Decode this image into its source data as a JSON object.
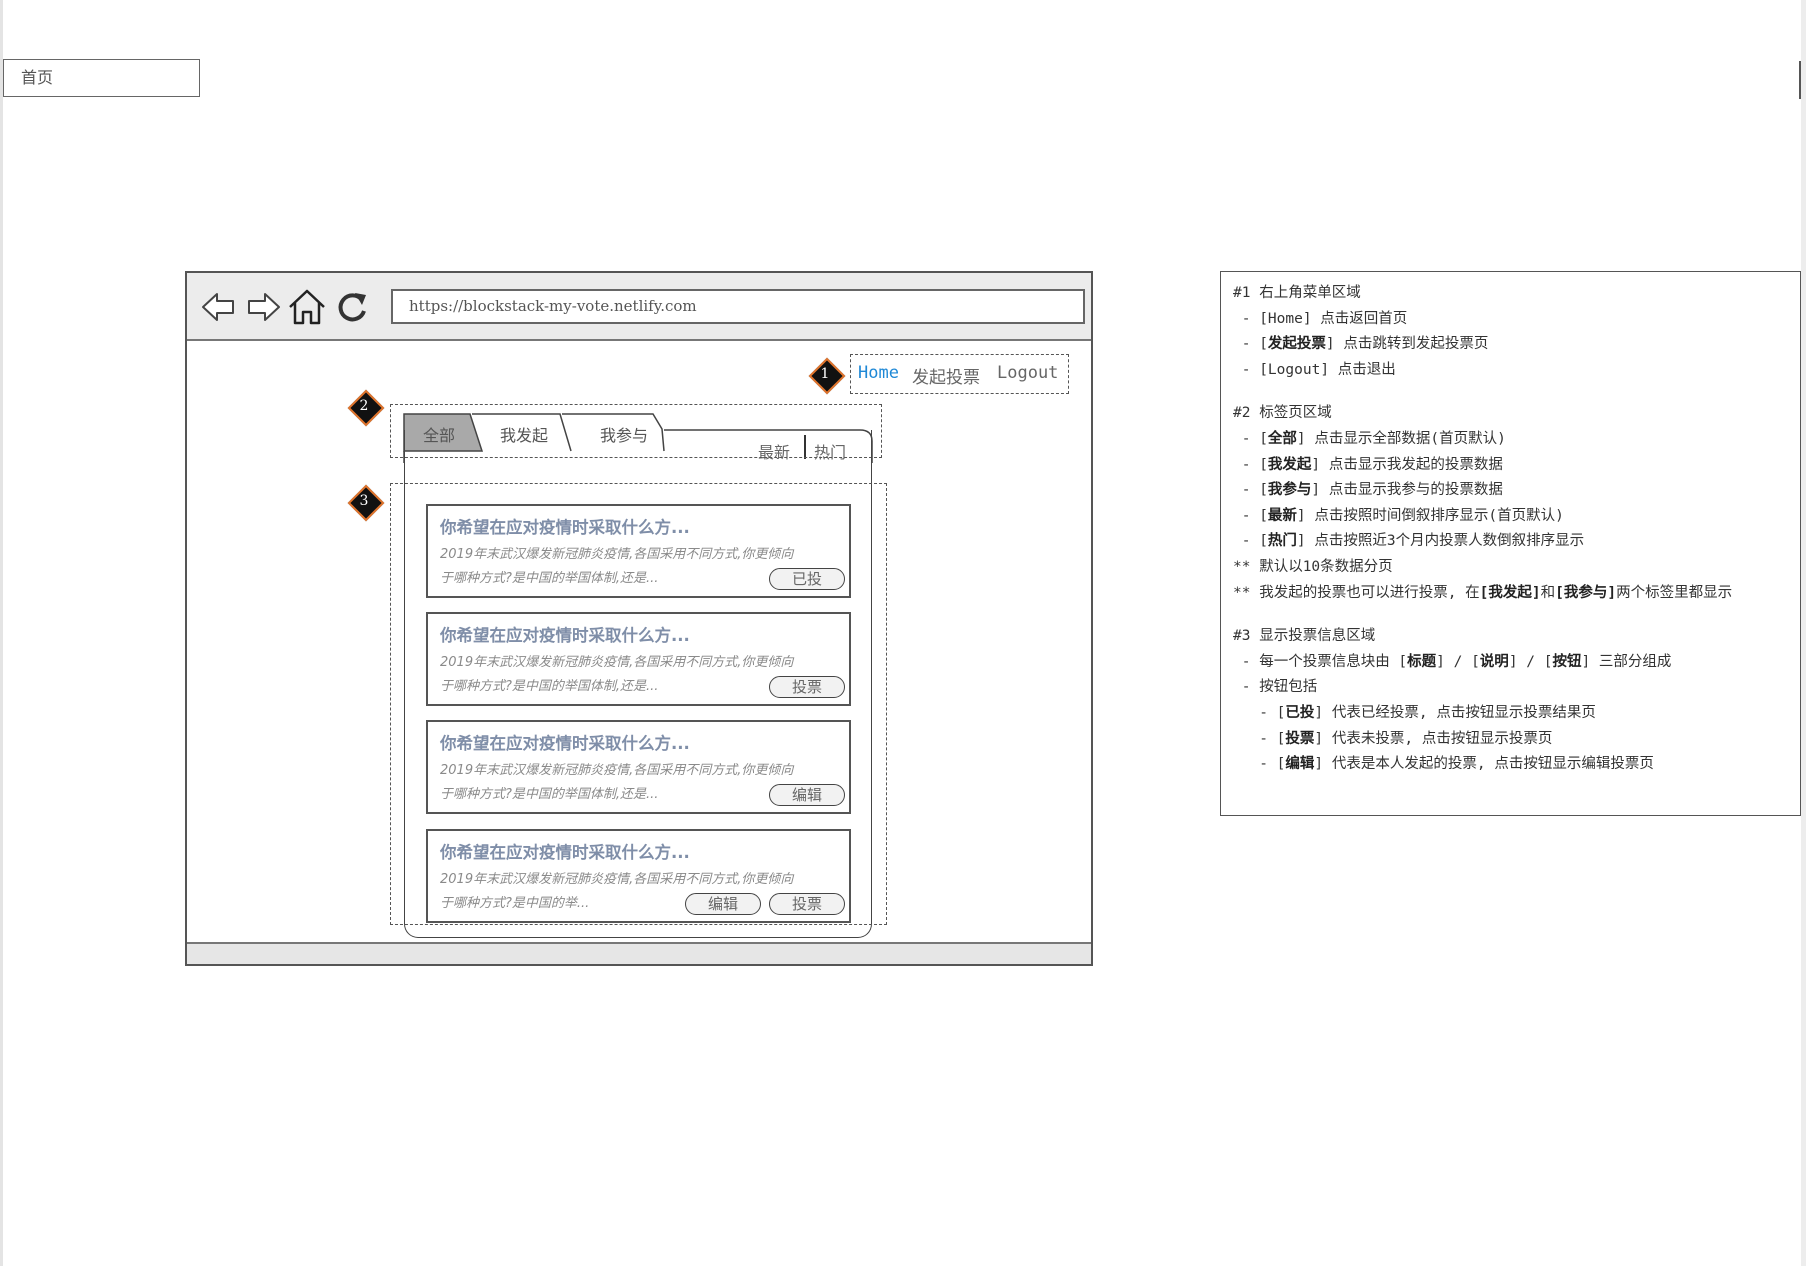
{
  "page_tab": "首页",
  "browser": {
    "url": "https://blockstack-my-vote.netlify.com",
    "icons": [
      "back-arrow-icon",
      "forward-arrow-icon",
      "home-icon",
      "refresh-icon"
    ]
  },
  "markers": [
    "1",
    "2",
    "3"
  ],
  "menu": {
    "home": "Home",
    "create": "发起投票",
    "logout": "Logout"
  },
  "tabs": {
    "all": "全部",
    "mine": "我发起",
    "joined": "我参与"
  },
  "sort": {
    "latest": "最新",
    "hot": "热门"
  },
  "cards": [
    {
      "title": "你希望在应对疫情时采取什么方...",
      "desc1": "2019年末武汉爆发新冠肺炎疫情,各国采用不同方式,你更倾向",
      "desc2": "于哪种方式?是中国的举国体制,还是...",
      "buttons": [
        "已投"
      ]
    },
    {
      "title": "你希望在应对疫情时采取什么方...",
      "desc1": "2019年末武汉爆发新冠肺炎疫情,各国采用不同方式,你更倾向",
      "desc2": "于哪种方式?是中国的举国体制,还是...",
      "buttons": [
        "投票"
      ]
    },
    {
      "title": "你希望在应对疫情时采取什么方...",
      "desc1": "2019年末武汉爆发新冠肺炎疫情,各国采用不同方式,你更倾向",
      "desc2": "于哪种方式?是中国的举国体制,还是...",
      "buttons": [
        "编辑"
      ]
    },
    {
      "title": "你希望在应对疫情时采取什么方...",
      "desc1": "2019年末武汉爆发新冠肺炎疫情,各国采用不同方式,你更倾向",
      "desc2": "于哪种方式?是中国的举...",
      "buttons": [
        "编辑",
        "投票"
      ]
    }
  ],
  "notes": {
    "s1_title": "#1 右上角菜单区域",
    "s1_home_a": " - [",
    "s1_home_b": "Home",
    "s1_home_c": "] 点击返回首页",
    "s1_create_a": " - [",
    "s1_create_b": "发起投票",
    "s1_create_c": "] 点击跳转到发起投票页",
    "s1_logout_a": " - [",
    "s1_logout_b": "Logout",
    "s1_logout_c": "] 点击退出",
    "s2_title": "#2 标签页区域",
    "s2_l1": "全部",
    "s2_l1_c": "点击显示全部数据(首页默认)",
    "s2_l2": "我发起",
    "s2_l2_c": "点击显示我发起的投票数据",
    "s2_l3": "我参与",
    "s2_l3_c": "点击显示我参与的投票数据",
    "s2_l4": "最新",
    "s2_l4_c": "点击按照时间倒叙排序显示(首页默认)",
    "s2_l5": "热门",
    "s2_l5_c": "点击按照近3个月内投票人数倒叙排序显示",
    "s2_n1": "** 默认以10条数据分页",
    "s2_n2_a": "** 我发起的投票也可以进行投票, 在",
    "s2_n2_b": "[我发起]",
    "s2_n2_c": "和",
    "s2_n2_d": "[我参与]",
    "s2_n2_e": "两个标签里都显示",
    "s3_title": "#3 显示投票信息区域",
    "s3_l1_a": " - 每一个投票信息块由 [",
    "s3_l1_b": "标题",
    "s3_l1_c": "] / [",
    "s3_l1_d": "说明",
    "s3_l1_e": "] / [",
    "s3_l1_f": "按钮",
    "s3_l1_g": "] 三部分组成",
    "s3_l2": " - 按钮包括",
    "s3_b1": "已投",
    "s3_b1_c": "代表已经投票, 点击按钮显示投票结果页",
    "s3_b2": "投票",
    "s3_b2_c": "代表未投票, 点击按钮显示投票页",
    "s3_b3": "编辑",
    "s3_b3_c": "代表是本人发起的投票, 点击按钮显示编辑投票页"
  }
}
